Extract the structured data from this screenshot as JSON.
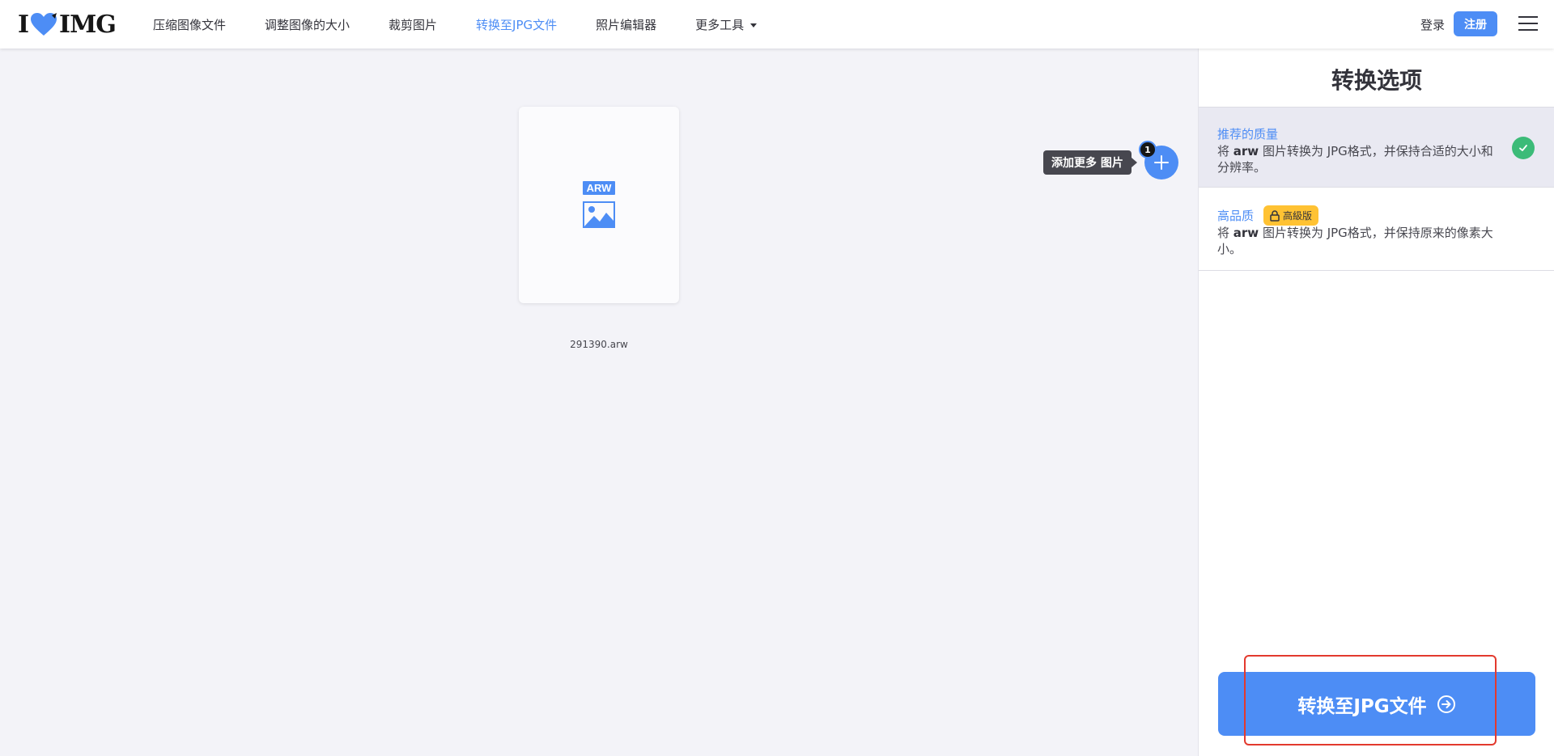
{
  "header": {
    "logo_text_left": "I",
    "logo_text_right": "IMG",
    "nav": [
      {
        "label": "压缩图像文件"
      },
      {
        "label": "调整图像的大小"
      },
      {
        "label": "裁剪图片"
      },
      {
        "label": "转换至JPG文件"
      },
      {
        "label": "照片编辑器"
      },
      {
        "label": "更多工具"
      }
    ],
    "login_label": "登录",
    "signup_label": "注册"
  },
  "main": {
    "file": {
      "badge": "ARW",
      "name": "291390.arw"
    },
    "add_more_label": "添加更多 图片",
    "file_count": "1"
  },
  "sidebar": {
    "title": "转换选项",
    "options": [
      {
        "title": "推荐的质量",
        "desc_prefix": "将 ",
        "desc_format": "arw",
        "desc_suffix": " 图片转换为 JPG格式，并保持合适的大小和分辨率。",
        "selected": true
      },
      {
        "title": "高品质",
        "badge": "高級版",
        "desc_prefix": "将 ",
        "desc_format": "arw",
        "desc_suffix": " 图片转换为 JPG格式，并保持原来的像素大小。",
        "selected": false
      }
    ],
    "convert_button_label": "转换至JPG文件"
  },
  "colors": {
    "accent": "#4d8df5",
    "success": "#3cbb78",
    "premium": "#ffc233",
    "highlight": "#e33a2e"
  },
  "icons": {
    "logo": "heart-icon",
    "add": "plus-icon",
    "selected": "check-icon",
    "premium": "lock-icon",
    "convert": "arrow-circle-right-icon",
    "menu": "hamburger-icon",
    "file": "image-icon"
  }
}
